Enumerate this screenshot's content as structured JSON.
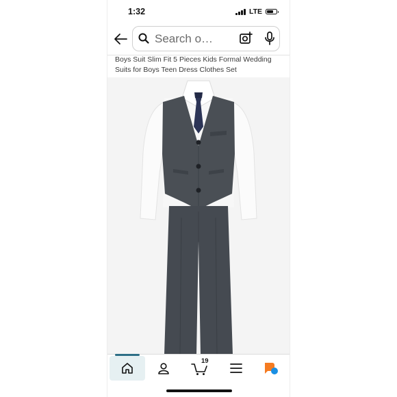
{
  "status_bar": {
    "time": "1:32",
    "network": "LTE"
  },
  "search": {
    "placeholder": "Search o…"
  },
  "product": {
    "title": "Boys Suit Slim Fit 5 Pieces Kids Formal Wedding Suits for Boys Teen Dress Clothes Set"
  },
  "bottom_nav": {
    "cart_count": "19",
    "items": [
      "home-icon",
      "account-icon",
      "cart-icon",
      "menu-icon",
      "assistant-icon"
    ]
  },
  "colors": {
    "accent": "#2d6f86",
    "assistant_orange": "#f57b21",
    "assistant_blue": "#1a8fe3"
  }
}
